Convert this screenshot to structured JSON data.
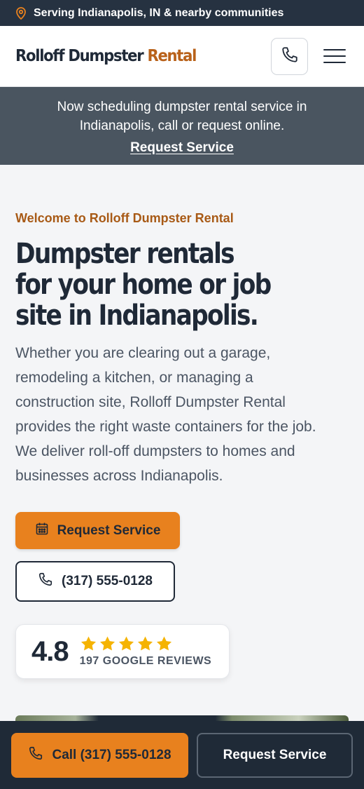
{
  "topbar": {
    "location_text": "Serving Indianapolis, IN & nearby communities",
    "icon": "map-pin-icon"
  },
  "header": {
    "logo_main": "Rolloff Dumpster",
    "logo_accent": "Rental",
    "phone_icon": "phone-icon",
    "menu_icon": "hamburger-menu-icon"
  },
  "announcement": {
    "line1": "Now scheduling dumpster rental service in",
    "line2": "Indianapolis, call or request online.",
    "link": "Request Service"
  },
  "hero": {
    "eyebrow": "Welcome to Rolloff Dumpster Rental",
    "headline_lines": [
      "Dumpster rentals",
      "for your home or job",
      "site in Indianapolis."
    ],
    "body_lines": [
      "Whether you are clearing out a garage,",
      "remodeling a kitchen, or managing a",
      "construction site, Rolloff Dumpster Rental",
      "provides the right waste containers for the job.",
      "We deliver roll-off dumpsters to homes and",
      "businesses across Indianapolis."
    ],
    "primary_cta": "Request Service",
    "secondary_cta": "(317) 555-0128"
  },
  "rating": {
    "score": "4.8",
    "stars": 5,
    "reviews": "197 GOOGLE REVIEWS"
  },
  "bottom_bar": {
    "call_label": "Call (317) 555-0128",
    "request_label": "Request Service"
  },
  "colors": {
    "accent": "#e8811e",
    "dark": "#1f2937",
    "topbar_bg": "#263241",
    "announce_bg": "#4a5560",
    "star": "#f5b301"
  }
}
